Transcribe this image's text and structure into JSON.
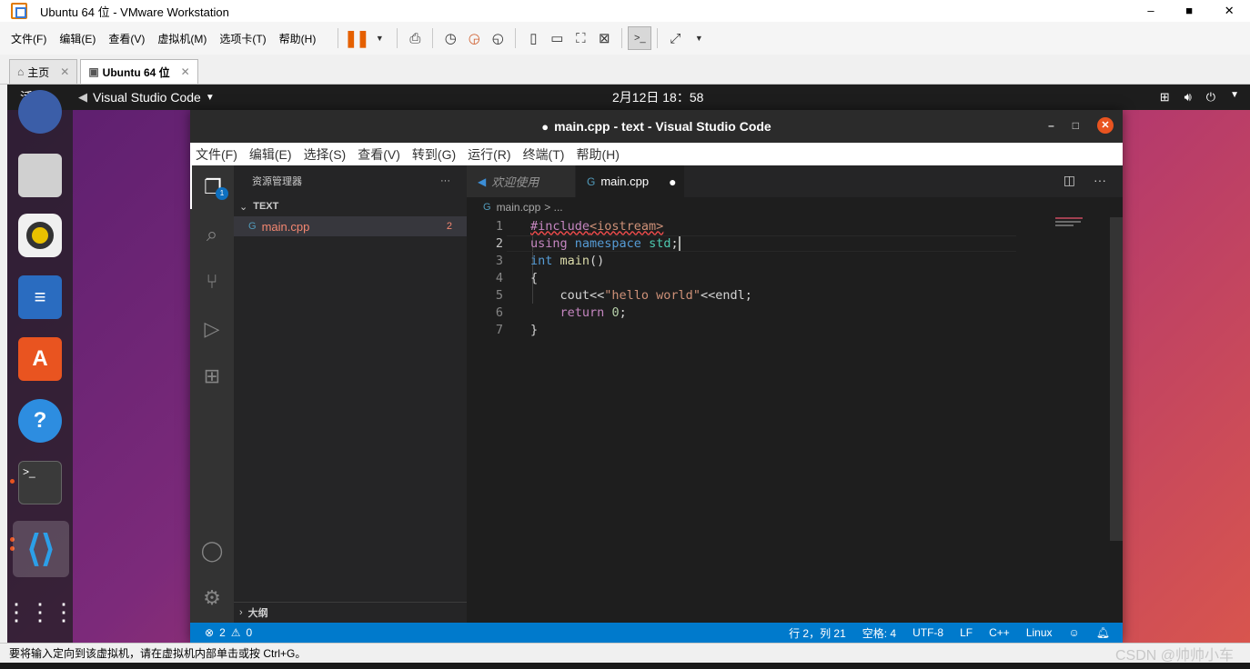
{
  "vm": {
    "title": "Ubuntu 64 位 - VMware Workstation",
    "window_controls": [
      "–",
      "■",
      "✕"
    ],
    "menu": [
      "文件(F)",
      "编辑(E)",
      "查看(V)",
      "虚拟机(M)",
      "选项卡(T)",
      "帮助(H)"
    ],
    "tabs": [
      {
        "label": "主页",
        "active": false
      },
      {
        "label": "Ubuntu 64 位",
        "active": true
      }
    ],
    "status_text": "要将输入定向到该虚拟机，请在虚拟机内部单击或按 Ctrl+G。",
    "watermark": "CSDN @帅帅小车"
  },
  "gnome": {
    "activities": "活动",
    "app_name": "Visual Studio Code",
    "clock": "2月12日  18：58"
  },
  "vscode": {
    "window_title": "main.cpp - text - Visual Studio Code",
    "menu": [
      "文件(F)",
      "编辑(E)",
      "选择(S)",
      "查看(V)",
      "转到(G)",
      "运行(R)",
      "终端(T)",
      "帮助(H)"
    ],
    "explorer_title": "资源管理器",
    "explorer_more": "···",
    "folder": "TEXT",
    "file": "main.cpp",
    "file_problems": "2",
    "outline": "大纲",
    "badge": "1",
    "tabs": [
      {
        "label": "欢迎使用",
        "active": false
      },
      {
        "label": "main.cpp",
        "active": true
      }
    ],
    "breadcrumb": "main.cpp",
    "breadcrumb_more": "> ...",
    "line_numbers": [
      "1",
      "2",
      "3",
      "4",
      "5",
      "6",
      "7"
    ],
    "status": {
      "errors": "2",
      "warnings": "0",
      "position": "行 2，列 21",
      "spaces": "空格: 4",
      "encoding": "UTF-8",
      "eol": "LF",
      "language": "C++",
      "os": "Linux"
    }
  },
  "colors": {
    "vscode_statusbar": "#007acc",
    "ubuntu_accent": "#e95420"
  }
}
